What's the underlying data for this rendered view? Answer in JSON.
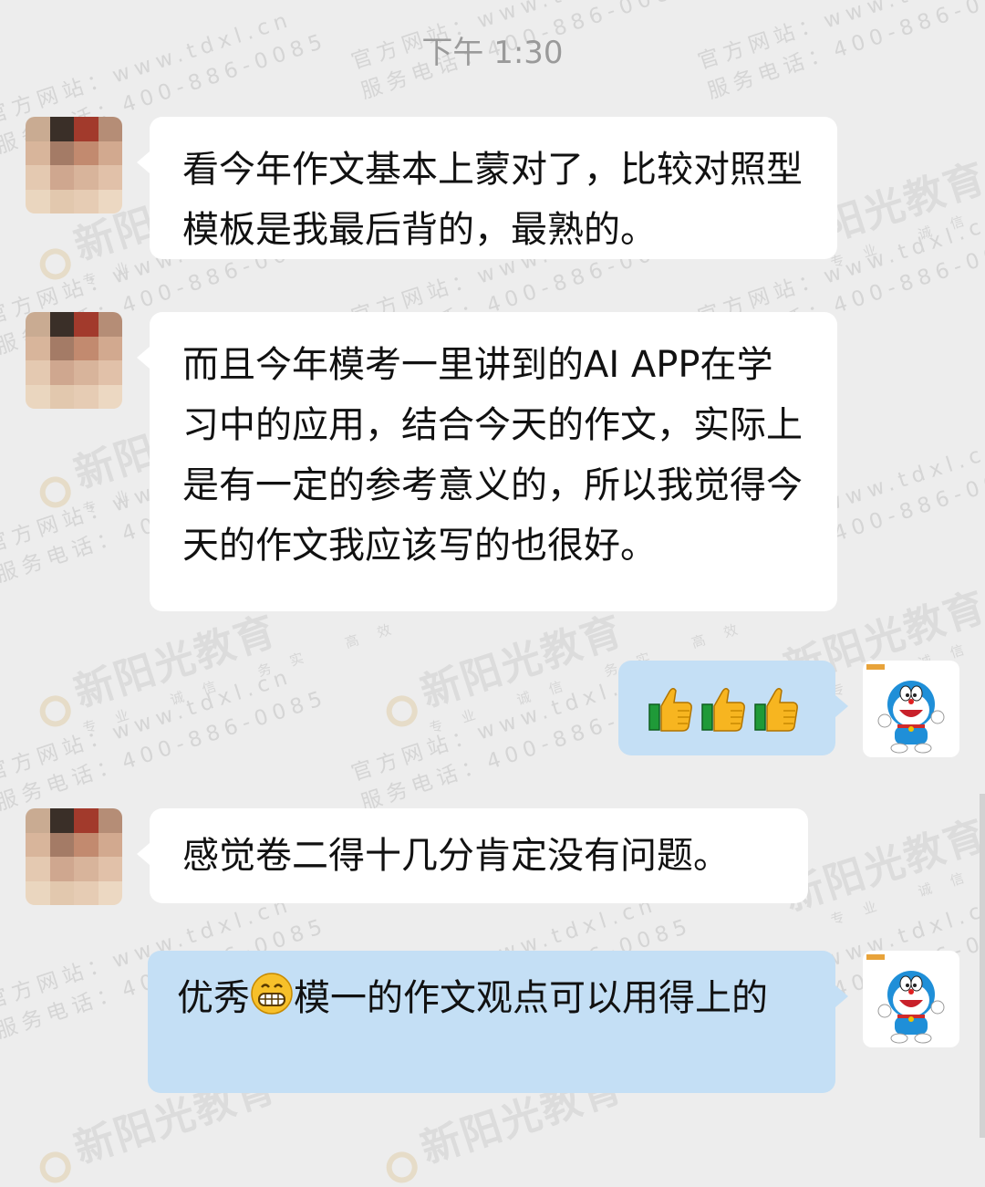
{
  "timestamp": "下午 1:30",
  "watermark": {
    "brand": "新阳光教育",
    "tags": "专业 诚信 务实 高效",
    "site": "官方网站：www.tdxl.cn",
    "phone": "服务电话：400-886-0085"
  },
  "messages": [
    {
      "side": "left",
      "text": "看今年作文基本上蒙对了，比较对照型模板是我最后背的，最熟的。"
    },
    {
      "side": "left",
      "text": "而且今年模考一里讲到的AI APP在学习中的应用，结合今天的作文，实际上是有一定的参考意义的，所以我觉得今天的作文我应该写的也很好。"
    },
    {
      "side": "right",
      "emoji": [
        "thumbs-up",
        "thumbs-up",
        "thumbs-up"
      ]
    },
    {
      "side": "left",
      "text": "感觉卷二得十几分肯定没有问题。"
    },
    {
      "side": "right",
      "text_before": "优秀",
      "emoji": "grinning-face",
      "text_after": "模一的作文观点可以用得上的"
    }
  ],
  "colors": {
    "background": "#ededed",
    "incoming_bubble": "#ffffff",
    "outgoing_bubble": "#c4dff5",
    "timestamp": "#9a9a9a"
  }
}
